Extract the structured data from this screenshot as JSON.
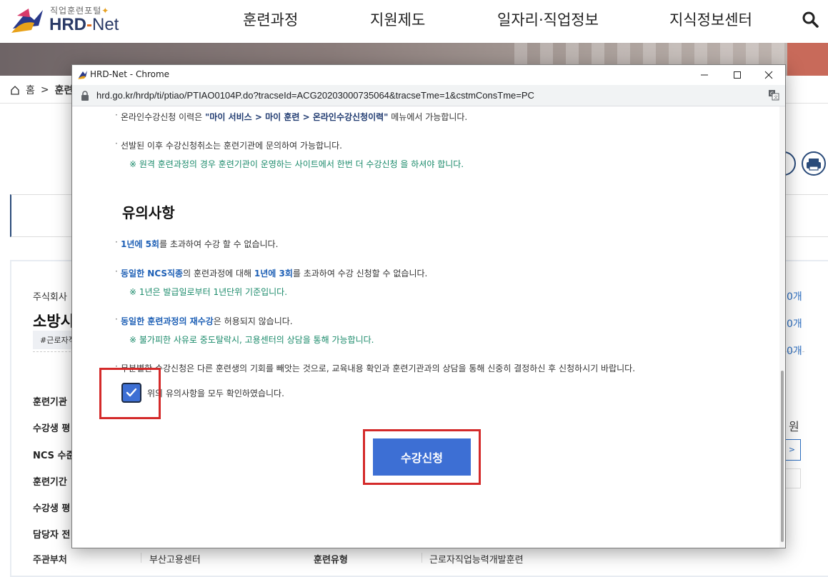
{
  "site": {
    "logo_small": "직업훈련포털",
    "logo_main_hrd": "HRD",
    "logo_main_dash": "-",
    "logo_main_net": "Net",
    "nav": [
      "훈련과정",
      "지원제도",
      "일자리·직업정보",
      "지식정보센터"
    ],
    "breadcrumb": [
      "홈",
      ">",
      "훈련"
    ],
    "company": "주식회사",
    "course_title": "소방시",
    "tag": "#근로자직",
    "rows": [
      "훈련기관",
      "수강생 평",
      "NCS 수준",
      "훈련기간",
      "수강생 평",
      "담당자 전"
    ],
    "counts": [
      "0개",
      "0개",
      "0개"
    ],
    "won": "원",
    "side_button": ">",
    "bottom": {
      "label1": "주관부처",
      "value1": "부산고용센터",
      "label2": "훈련유형",
      "value2": "근로자직업능력개발훈련"
    }
  },
  "popup": {
    "window_title": "HRD-Net - Chrome",
    "url": "hrd.go.kr/hrdp/ti/ptiao/PTIAO0104P.do?tracseId=ACG20203000735064&tracseTme=1&cstmConsTme=PC",
    "top_items": {
      "item1_pre": "온라인수강신청 이력은 ",
      "item1_hl": "\"마이 서비스 > 마이 훈련 > 온라인수강신청이력\"",
      "item1_post": " 메뉴에서 가능합니다.",
      "item2": "선발된 이후 수강신청취소는 훈련기관에 문의하여 가능합니다.",
      "item2_note": "※ 원격 훈련과정의 경우 훈련기관이 운영하는 사이트에서 한번 더 수강신청 을 하셔야 합니다."
    },
    "section_title": "유의사항",
    "notes": {
      "n1_hl": "1년에 5회",
      "n1_post": "를 초과하여 수강 할 수 없습니다.",
      "n2_hl1": "동일한 NCS직종",
      "n2_mid": "의 훈련과정에 대해 ",
      "n2_hl2": "1년에 3회",
      "n2_post": "를 초과하여 수강 신청할 수 없습니다.",
      "n2_note": "※ 1년은 발급일로부터 1년단위 기준입니다.",
      "n3_hl": "동일한 훈련과정의 재수강",
      "n3_post": "은 허용되지 않습니다.",
      "n3_note": "※ 불가피한 사유로 중도탈락시, 고용센터의 상담을 통해 가능합니다.",
      "n4": "무분별한 수강신청은 다른 훈련생의 기회를 빼앗는 것으로, 교육내용 확인과 훈련기관과의 상담을 통해 신중히 결정하신 후 신청하시기 바랍니다."
    },
    "checkbox_label": "위의 유의사항을 모두 확인하였습니다.",
    "checkbox_checked": true,
    "submit_label": "수강신청"
  },
  "colors": {
    "accent_blue": "#3d6fd4",
    "highlight_red": "#d42a2a",
    "note_green": "#1a8a6a"
  }
}
